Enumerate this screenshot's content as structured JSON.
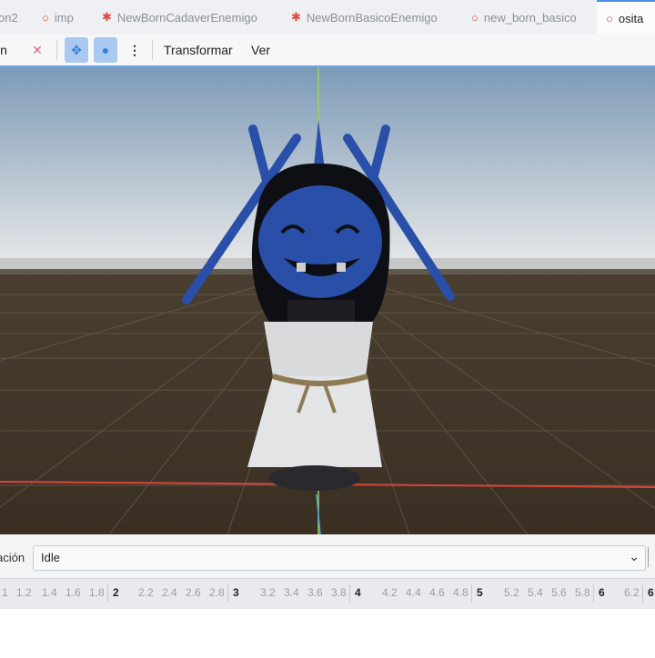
{
  "tabs": [
    {
      "label": "on2",
      "icon": "none"
    },
    {
      "label": "imp",
      "icon": "scene-ring-icon"
    },
    {
      "label": "NewBornCadaverEnemigo",
      "icon": "character-icon"
    },
    {
      "label": "NewBornBasicoEnemigo",
      "icon": "character-icon"
    },
    {
      "label": "new_born_basico",
      "icon": "scene-ring-icon"
    },
    {
      "label": "osita",
      "icon": "scene-ring-icon"
    }
  ],
  "toolbar": {
    "cut_label": "n",
    "transform_label": "Transformar",
    "view_label": "Ver"
  },
  "animation": {
    "label": "ación",
    "selected": "Idle"
  },
  "timeline": {
    "ticks": [
      "1",
      "1.2",
      "1.4",
      "1.6",
      "1.8",
      "2",
      "2.2",
      "2.4",
      "2.6",
      "2.8",
      "3",
      "3.2",
      "3.4",
      "3.6",
      "3.8",
      "4",
      "4.2",
      "4.4",
      "4.6",
      "4.8",
      "5",
      "5.2",
      "5.4",
      "5.6",
      "5.8",
      "6",
      "6.2",
      "6"
    ],
    "major": [
      "2",
      "3",
      "4",
      "5",
      "6"
    ]
  },
  "colors": {
    "accent": "#4a8fe6",
    "ring": "#e0473f",
    "floor": "#3f3426",
    "sky_top": "#7d9ab7",
    "character_blue": "#2a4fa8"
  }
}
